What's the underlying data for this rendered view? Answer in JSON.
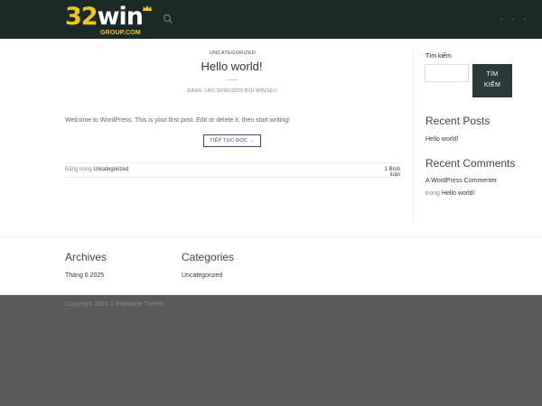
{
  "header": {
    "logo": {
      "number": "32",
      "word": "win",
      "sub": "GROUP.COM"
    },
    "accent": "#f5c518",
    "background": "#1b2a26"
  },
  "post": {
    "category": "UNCATEGORIZED",
    "title": "Hello world!",
    "meta": "ĐĂNG VÀO 30/06/2025 BỞI WINSEO",
    "excerpt": "Welcome to WordPress. This is your first post. Edit or delete it, then start writing!",
    "read_more": "TIẾP TỤC ĐỌC →",
    "posted_in_prefix": "Đăng trong",
    "posted_in_category": "Uncategorized",
    "comments": "1 Bình luận"
  },
  "sidebar": {
    "search_label": "Tìm kiếm",
    "search_input_value": "",
    "search_button_line1": "TÌM",
    "search_button_line2": "KIẾM",
    "recent_posts_title": "Recent Posts",
    "recent_posts": [
      "Hello world!"
    ],
    "recent_comments_title": "Recent Comments",
    "comment_author": "A WordPress Commenter",
    "comment_on_prefix": "trong",
    "comment_post": "Hello world!"
  },
  "footer_widgets": {
    "archives_title": "Archives",
    "archives_link": "Tháng 6 2025",
    "categories_title": "Categories",
    "categories_link": "Uncategorized"
  },
  "footer": {
    "copyright_prefix": "Copyright 2025 ©",
    "theme": "Flatsome Theme"
  },
  "icons": {
    "search": "search-icon",
    "menu": "menu-dots-icon",
    "crown": "crown-icon"
  }
}
